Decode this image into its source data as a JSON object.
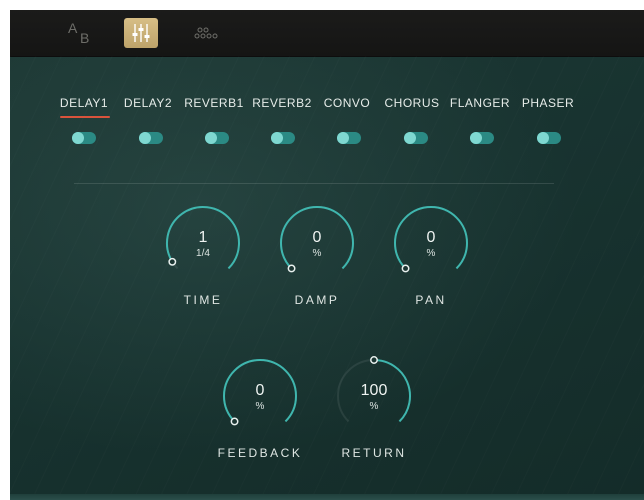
{
  "toolbar": {
    "ab_letters": [
      "A",
      "B"
    ],
    "active_icon": "mixer-sliders-icon",
    "icons": [
      "ab-compare-icon",
      "mixer-sliders-icon",
      "routing-dots-icon"
    ],
    "accent_color": "#c9ad72"
  },
  "tabs": [
    {
      "label": "DELAY1",
      "active": true
    },
    {
      "label": "DELAY2",
      "active": false
    },
    {
      "label": "REVERB1",
      "active": false
    },
    {
      "label": "REVERB2",
      "active": false
    },
    {
      "label": "CONVO",
      "active": false
    },
    {
      "label": "CHORUS",
      "active": false
    },
    {
      "label": "FLANGER",
      "active": false
    },
    {
      "label": "PHASER",
      "active": false
    }
  ],
  "tab_underline_color": "#d9533c",
  "toggle_color": "#2b8a84",
  "knobs": [
    {
      "id": "time",
      "value": "1",
      "sub": "1/4",
      "label": "TIME",
      "level": 0.05
    },
    {
      "id": "damp",
      "value": "0",
      "sub": "%",
      "label": "DAMP",
      "level": 0.0
    },
    {
      "id": "pan",
      "value": "0",
      "sub": "%",
      "label": "PAN",
      "level": 0.0
    },
    {
      "id": "feedback",
      "value": "0",
      "sub": "%",
      "label": "FEEDBACK",
      "level": 0.0
    },
    {
      "id": "return",
      "value": "100",
      "sub": "%",
      "label": "RETURN",
      "level": 0.5
    }
  ]
}
